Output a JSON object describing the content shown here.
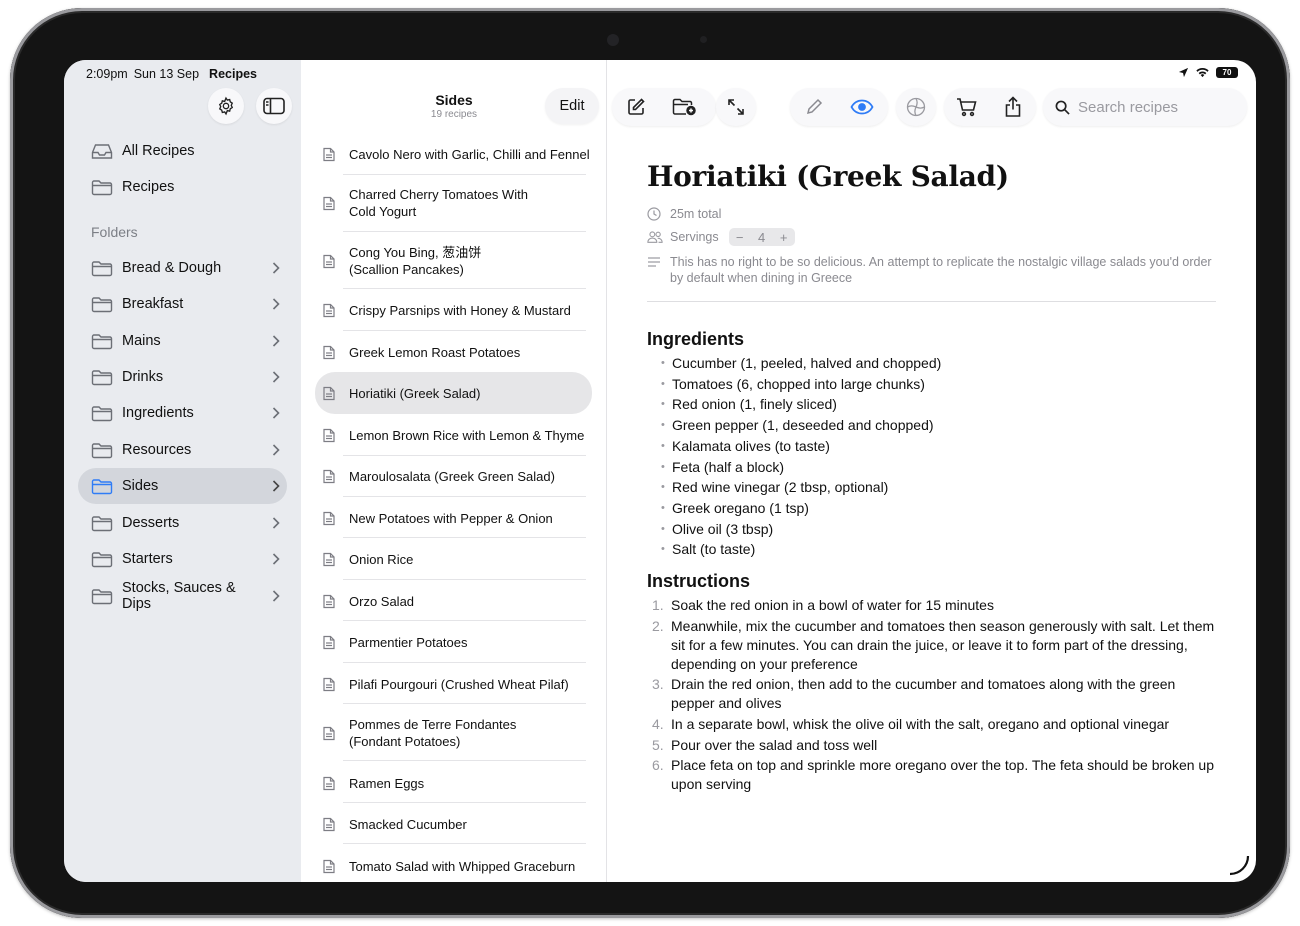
{
  "status_bar": {
    "time": "2:09pm",
    "date": "Sun 13 Sep",
    "app": "Recipes",
    "battery": "70"
  },
  "sidebar": {
    "top_items": [
      {
        "label": "All Recipes",
        "icon": "tray-icon"
      },
      {
        "label": "Recipes",
        "icon": "folder-icon"
      }
    ],
    "folders_heading": "Folders",
    "folders": [
      {
        "label": "Bread & Dough"
      },
      {
        "label": "Breakfast"
      },
      {
        "label": "Mains"
      },
      {
        "label": "Drinks"
      },
      {
        "label": "Ingredients"
      },
      {
        "label": "Resources"
      },
      {
        "label": "Sides",
        "selected": true
      },
      {
        "label": "Desserts"
      },
      {
        "label": "Starters"
      },
      {
        "label": "Stocks, Sauces & Dips"
      }
    ]
  },
  "list": {
    "title": "Sides",
    "subtitle": "19 recipes",
    "edit_label": "Edit",
    "items": [
      {
        "label": "Cavolo Nero with Garlic, Chilli and Fennel"
      },
      {
        "label": "Charred Cherry Tomatoes With Cold Yogurt"
      },
      {
        "label": "Cong You Bing, 葱油饼 (Scallion Pancakes)"
      },
      {
        "label": "Crispy Parsnips with Honey & Mustard"
      },
      {
        "label": "Greek Lemon Roast Potatoes"
      },
      {
        "label": "Horiatiki (Greek Salad)",
        "selected": true
      },
      {
        "label": "Lemon Brown Rice with Lemon & Thyme"
      },
      {
        "label": "Maroulosalata (Greek Green Salad)"
      },
      {
        "label": "New Potatoes with Pepper & Onion"
      },
      {
        "label": "Onion Rice"
      },
      {
        "label": "Orzo Salad"
      },
      {
        "label": "Parmentier Potatoes"
      },
      {
        "label": "Pilafi Pourgouri (Crushed Wheat Pilaf)"
      },
      {
        "label": "Pommes de Terre Fondantes (Fondant Potatoes)"
      },
      {
        "label": "Ramen Eggs"
      },
      {
        "label": "Smacked Cucumber"
      },
      {
        "label": "Tomato Salad with Whipped Graceburn"
      }
    ]
  },
  "toolbar": {
    "search_placeholder": "Search recipes",
    "accent": "#2f7cf6"
  },
  "recipe": {
    "title": "Horiatiki (Greek Salad)",
    "total_time": "25m total",
    "servings_label": "Servings",
    "servings_value": "4",
    "description": "This has no right to be so delicious. An attempt to replicate the nostalgic village salads you'd order by default when dining in Greece",
    "ingredients_heading": "Ingredients",
    "ingredients": [
      "Cucumber (1, peeled, halved and chopped)",
      "Tomatoes (6, chopped into large chunks)",
      "Red onion (1, finely sliced)",
      "Green pepper (1, deseeded and chopped)",
      "Kalamata olives (to taste)",
      "Feta (half a block)",
      "Red wine vinegar (2 tbsp, optional)",
      "Greek oregano (1 tsp)",
      "Olive oil (3 tbsp)",
      "Salt (to taste)"
    ],
    "instructions_heading": "Instructions",
    "instructions": [
      {
        "num": "1.",
        "text": "Soak the red onion in a bowl of water for 15 minutes"
      },
      {
        "num": "2.",
        "text": "Meanwhile, mix the cucumber and tomatoes then season generously with salt. Let them sit for a few minutes. You can drain the juice, or leave it to form part of the dressing, depending on your preference"
      },
      {
        "num": "3.",
        "text": "Drain the red onion, then add to the cucumber and tomatoes along with the green pepper and olives"
      },
      {
        "num": "4.",
        "text": "In a separate bowl, whisk the olive oil with the salt, oregano and optional vinegar"
      },
      {
        "num": "5.",
        "text": "Pour over the salad and toss well"
      },
      {
        "num": "6.",
        "text": "Place feta on top and sprinkle more oregano over the top. The feta should be broken up upon serving"
      }
    ]
  }
}
